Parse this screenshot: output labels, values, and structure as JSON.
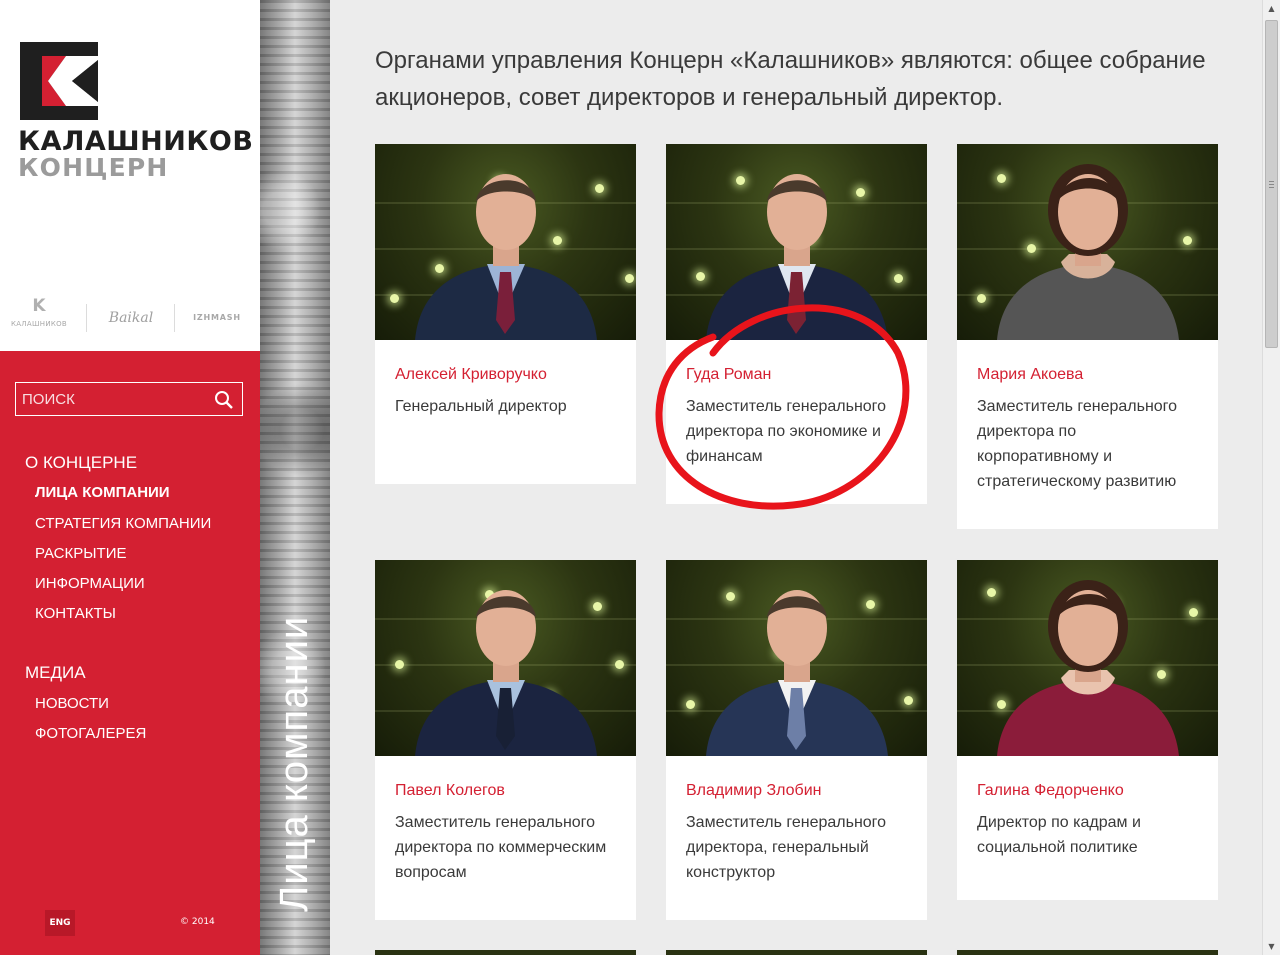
{
  "logo": {
    "word1": "КАЛАШНИКОВ",
    "word2": "КОНЦЕРН",
    "brand_color": "#d42032"
  },
  "brands": [
    {
      "name": "КАЛАШНИКОВ",
      "icon": "k-icon"
    },
    {
      "name": "Baikal"
    },
    {
      "name": "IZHMASH"
    }
  ],
  "search": {
    "placeholder": "ПОИСК",
    "value": ""
  },
  "nav": [
    {
      "heading": "О КОНЦЕРНЕ",
      "items": [
        {
          "label": "ЛИЦА КОМПАНИИ",
          "active": true
        },
        {
          "label": "СТРАТЕГИЯ КОМПАНИИ",
          "active": false
        },
        {
          "label": "РАСКРЫТИЕ",
          "active": false
        },
        {
          "label": "ИНФОРМАЦИИ",
          "active": false
        },
        {
          "label": "КОНТАКТЫ",
          "active": false
        }
      ]
    },
    {
      "heading": "МЕДИА",
      "items": [
        {
          "label": "НОВОСТИ",
          "active": false
        },
        {
          "label": "ФОТОГАЛЕРЕЯ",
          "active": false
        }
      ]
    }
  ],
  "lang": "ENG",
  "copyright": "© 2014",
  "strip_title": "Лица компании",
  "intro": "Органами управления Концерн «Калашников» являются: общее собрание акционеров, совет директоров и генеральный директор.",
  "people": [
    {
      "name": "Алексей Криворучко",
      "role": "Генеральный директор",
      "suit": "#1d2a44",
      "tie": "#7a1f3a",
      "shirt": "#9db4d6"
    },
    {
      "name": "Гуда Роман",
      "role": "Заместитель генерального директора по экономике и финансам",
      "suit": "#1b2440",
      "tie": "#7b2233",
      "shirt": "#dfe6f0"
    },
    {
      "name": "Мария Акоева",
      "role": "Заместитель генерального директора по корпоративному и стратегическому развитию",
      "suit": "#555555",
      "tie": "",
      "shirt": "#d8b29a"
    },
    {
      "name": "Павел Колегов",
      "role": "Заместитель генерального директора по коммерческим вопросам",
      "suit": "#1b2440",
      "tie": "#182035",
      "shirt": "#a9c1de"
    },
    {
      "name": "Владимир Злобин",
      "role": "Заместитель генерального директора, генеральный конструктор",
      "suit": "#263556",
      "tie": "#6d7fa7",
      "shirt": "#f2f2f2"
    },
    {
      "name": "Галина Федорченко",
      "role": "Директор по кадрам и социальной политике",
      "suit": "#8b1c3a",
      "tie": "",
      "shirt": "#e9c3ae"
    }
  ],
  "highlight_color": "#e8141b"
}
